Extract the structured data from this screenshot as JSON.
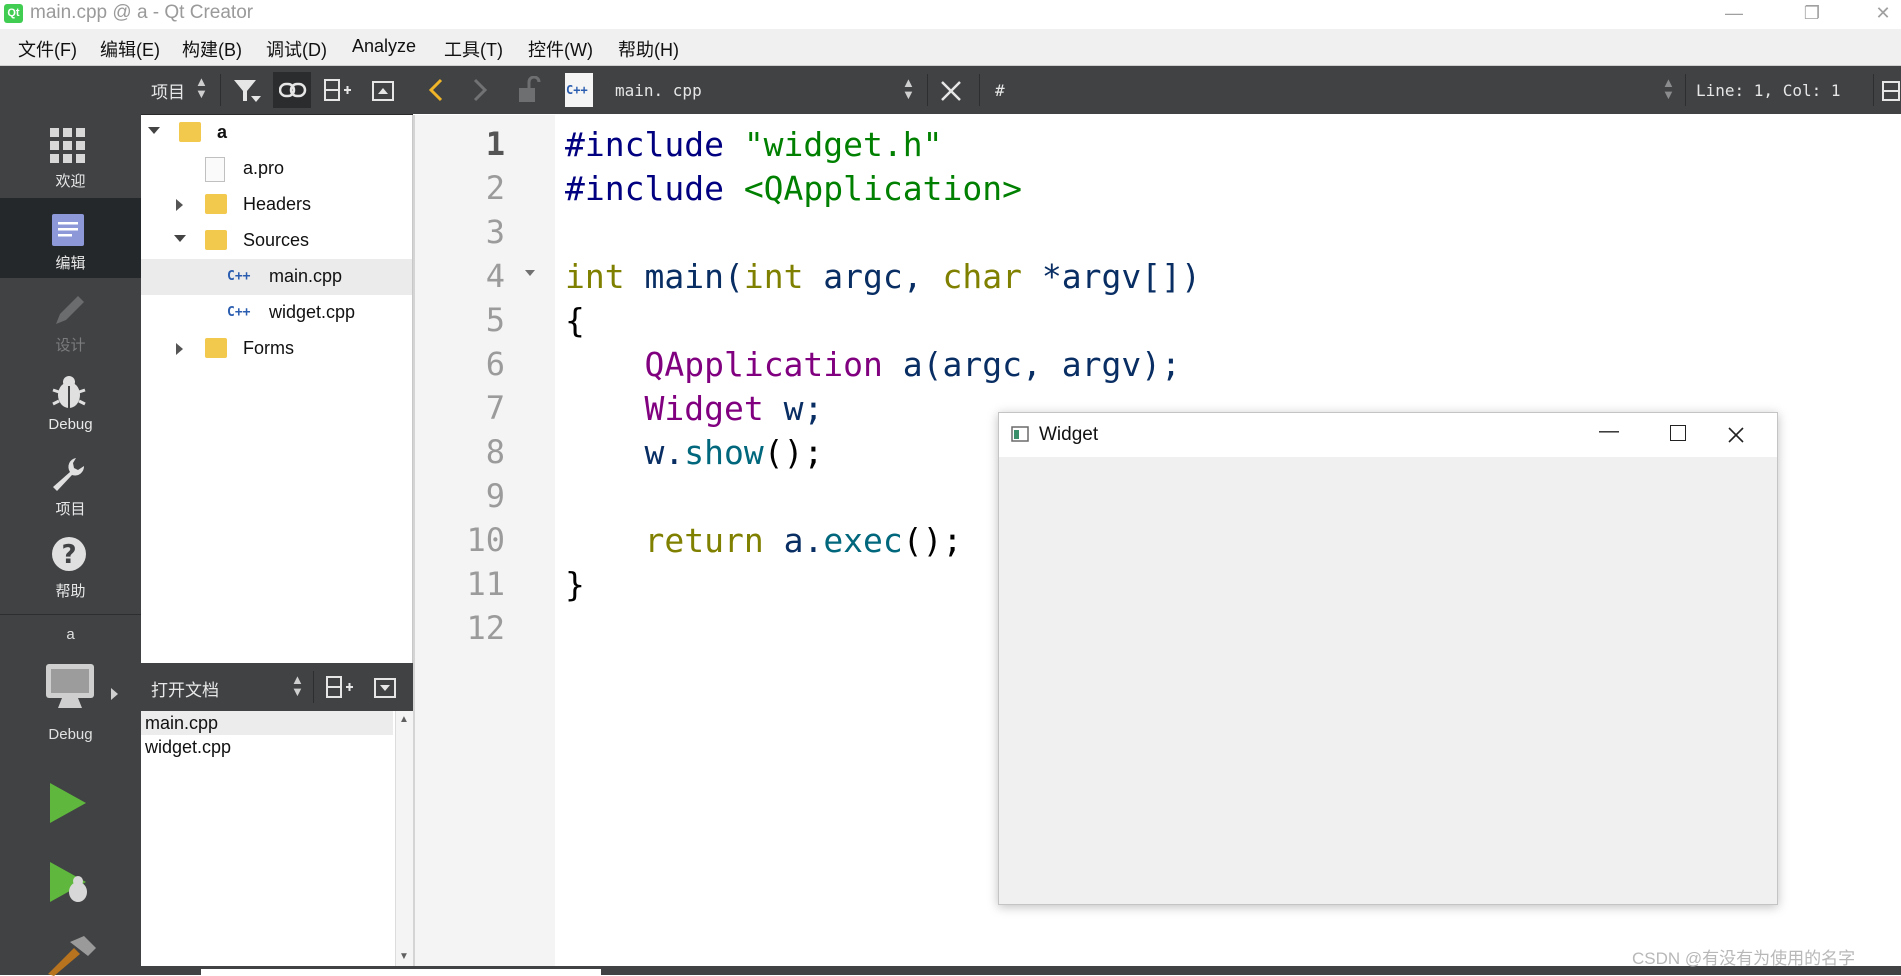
{
  "window": {
    "title": "main.cpp @ a - Qt Creator",
    "logo": "Qt"
  },
  "menu": [
    "文件(F)",
    "编辑(E)",
    "构建(B)",
    "调试(D)",
    "Analyze",
    "工具(T)",
    "控件(W)",
    "帮助(H)"
  ],
  "modes": {
    "welcome": "欢迎",
    "edit": "编辑",
    "design": "设计",
    "debug": "Debug",
    "projects": "项目",
    "help": "帮助",
    "kit_project": "a",
    "kit_config": "Debug"
  },
  "nav": {
    "selector_label": "项目",
    "tree": {
      "project": "a",
      "pro_file": "a.pro",
      "headers": "Headers",
      "sources": "Sources",
      "main_cpp": "main.cpp",
      "widget_cpp": "widget.cpp",
      "forms": "Forms"
    }
  },
  "open_docs": {
    "label": "打开文档",
    "items": [
      "main.cpp",
      "widget.cpp"
    ]
  },
  "editor": {
    "file_name": "main. cpp",
    "symbol": "#",
    "position": "Line: 1, Col: 1",
    "current_line": 1,
    "line_numbers": [
      "1",
      "2",
      "3",
      "4",
      "5",
      "6",
      "7",
      "8",
      "9",
      "10",
      "11",
      "12"
    ]
  },
  "code": {
    "l1_a": "#include ",
    "l1_b": "\"widget.h\"",
    "l2_a": "#include ",
    "l2_b": "<QApplication>",
    "l4_a": "int",
    "l4_b": " main(",
    "l4_c": "int",
    "l4_d": " argc, ",
    "l4_e": "char",
    "l4_f": " *argv[])",
    "l5": "{",
    "l6_a": "    ",
    "l6_b": "QApplication",
    "l6_c": " a(argc, argv);",
    "l7_a": "    ",
    "l7_b": "Widget",
    "l7_c": " w;",
    "l8_a": "    w.",
    "l8_b": "show",
    "l8_c": "();",
    "l10_a": "    ",
    "l10_b": "return",
    "l10_c": " a.",
    "l10_d": "exec",
    "l10_e": "();",
    "l11": "}"
  },
  "widget_window": {
    "title": "Widget"
  },
  "watermark": "CSDN @有没有为使用的名字"
}
